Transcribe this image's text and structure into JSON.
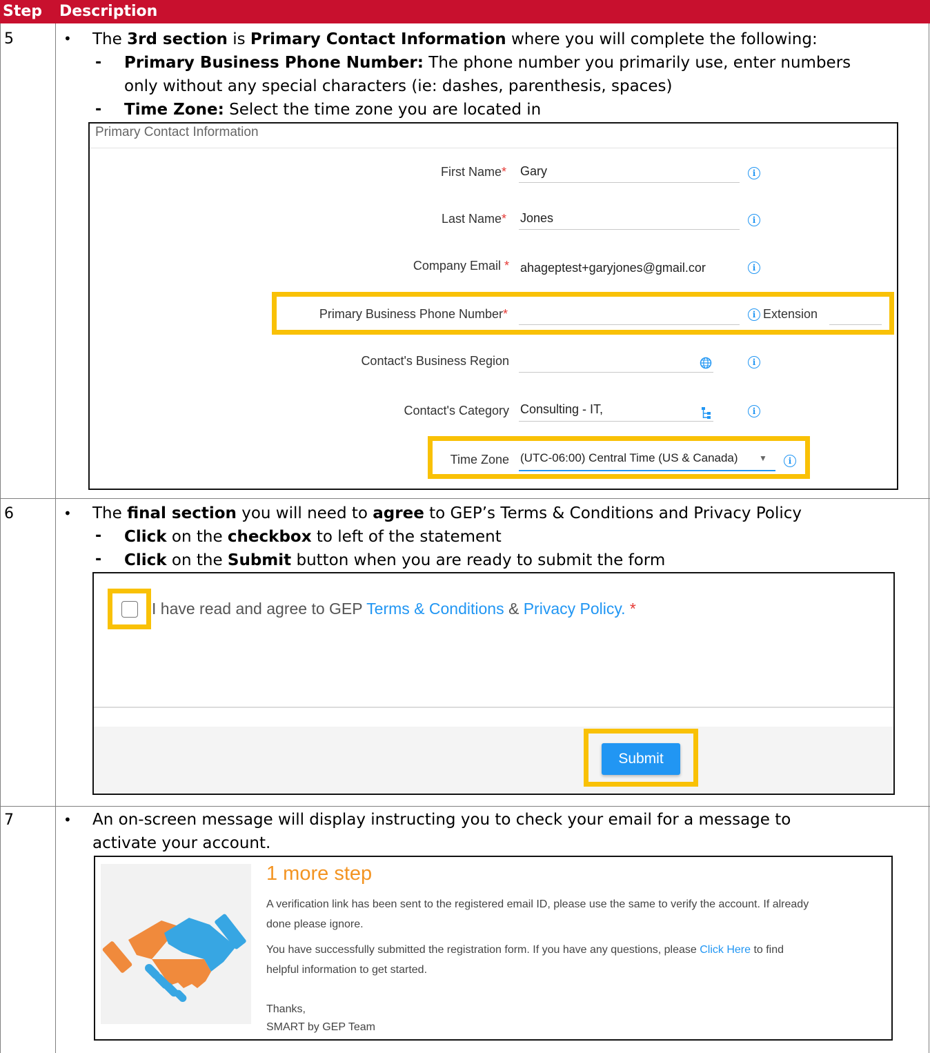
{
  "header": {
    "col_step": "Step",
    "col_desc": "Description"
  },
  "step5": {
    "num": "5",
    "line1_a": "The ",
    "line1_b": "3rd section",
    "line1_c": " is ",
    "line1_d": "Primary Contact Information",
    "line1_e": " where you will complete the following:",
    "sub1_bold": "Primary Business Phone Number:",
    "sub1_text": " The phone number you primarily use, enter numbers",
    "sub1_cont": "only without any special characters (ie: dashes, parenthesis, spaces)",
    "sub2_bold": "Time Zone:",
    "sub2_text": " Select the time zone you are located in",
    "form": {
      "section_title": "Primary Contact Information",
      "first_name_label": "First Name",
      "first_name_value": "Gary",
      "last_name_label": "Last Name",
      "last_name_value": "Jones",
      "email_label": "Company Email",
      "email_value": "ahageptest+garyjones@gmail.cor",
      "phone_label": "Primary Business Phone Number",
      "extension_label": "Extension",
      "region_label": "Contact's Business Region",
      "category_label": "Contact's Category",
      "category_value": "Consulting - IT,",
      "timezone_label": "Time Zone",
      "timezone_value": "(UTC-06:00) Central Time (US & Canada)"
    }
  },
  "step6": {
    "num": "6",
    "line1_a": "The ",
    "line1_b": "final section",
    "line1_c": " you will need to ",
    "line1_d": "agree",
    "line1_e": " to GEP’s Terms & Conditions and Privacy Policy",
    "sub1_b1": "Click",
    "sub1_t1": " on the ",
    "sub1_b2": "checkbox",
    "sub1_t2": " to left of the statement",
    "sub2_b1": "Click",
    "sub2_t1": " on the ",
    "sub2_b2": "Submit",
    "sub2_t2": " button when you are ready to submit the form",
    "agree_a": "I have read and agree to GEP ",
    "terms_link": "Terms & Conditions",
    "agree_amp": " & ",
    "privacy_link": "Privacy Policy.",
    "submit_label": "Submit"
  },
  "step7": {
    "num": "7",
    "line1": "An on-screen message will display instructing you to check your email for a message to",
    "line2": "activate your account.",
    "msg_title": "1 more step",
    "msg_p1_l1": "A verification link has been sent to the registered email ID, please use the same to verify the account. If already",
    "msg_p1_l2": "done please ignore.",
    "msg_p2_a": "You have successfully submitted the registration form. If you have any questions, please ",
    "msg_p2_link": "Click Here",
    "msg_p2_b": " to find",
    "msg_p2_l2": "helpful information to get started.",
    "thanks": "Thanks,",
    "team": "SMART by GEP Team"
  },
  "colors": {
    "header_red": "#c8102e",
    "highlight": "#f9c106",
    "link_blue": "#2196f3",
    "title_orange": "#f39422"
  },
  "icons": [
    "info-icon",
    "globe-icon",
    "tree-icon",
    "dropdown-arrow-icon",
    "handshake-icon"
  ]
}
